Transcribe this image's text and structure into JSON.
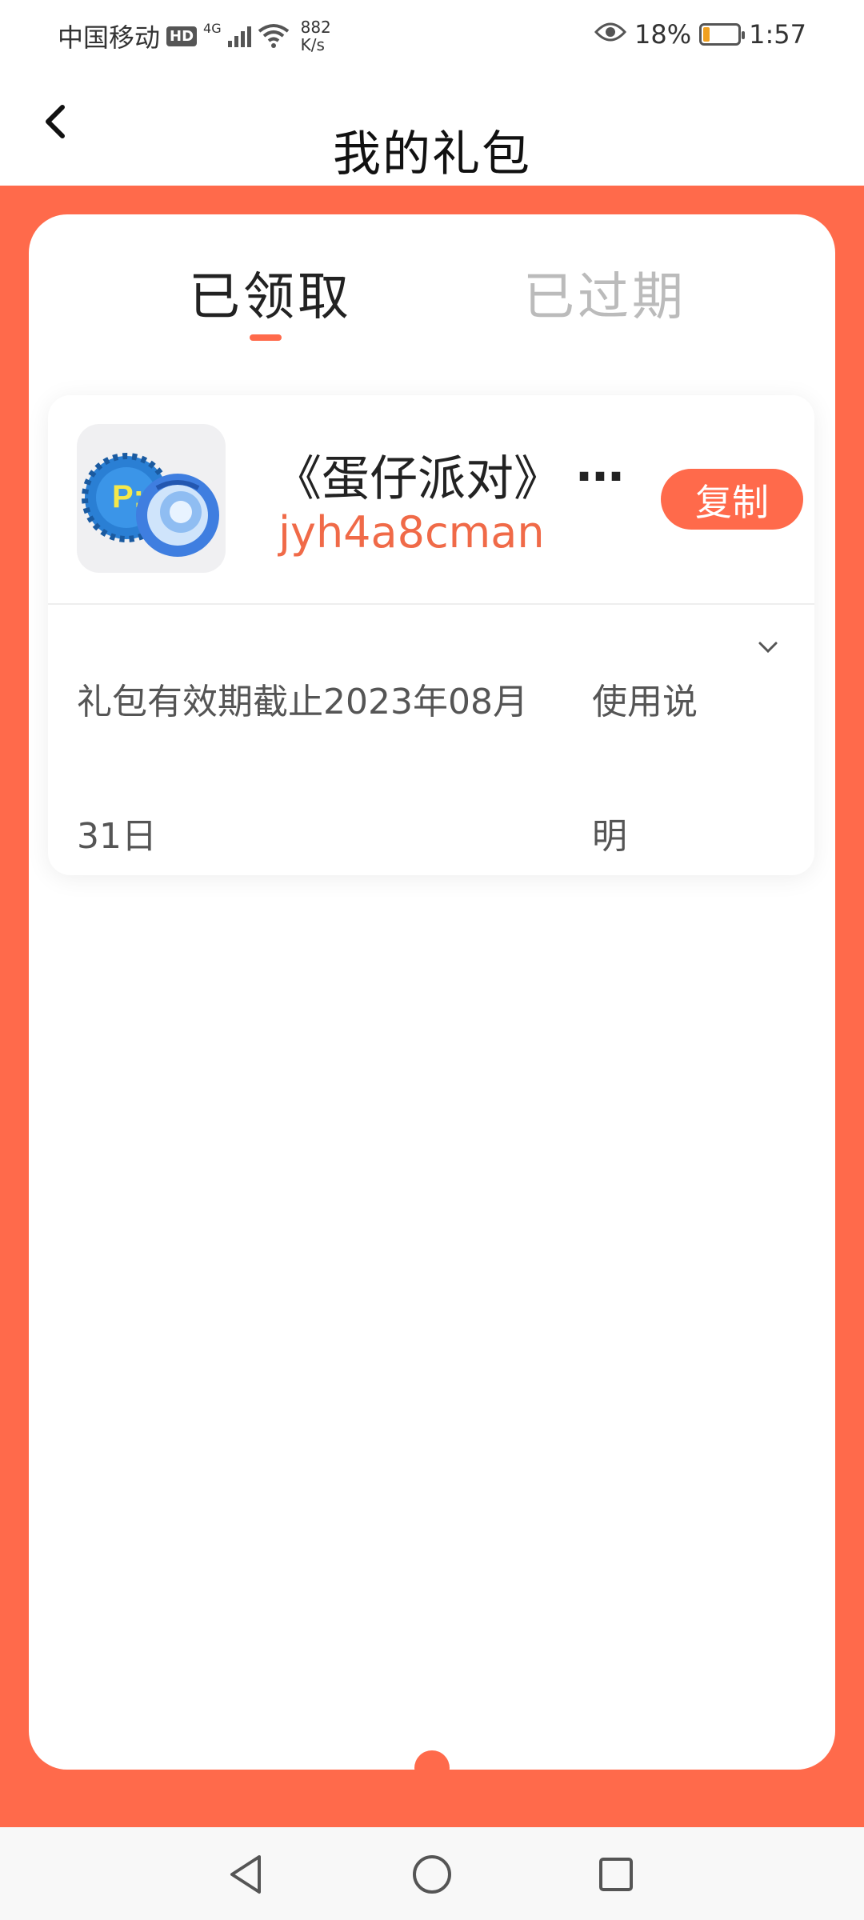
{
  "status_bar": {
    "carrier": "中国移动",
    "hd": "HD",
    "network": "4G",
    "speed_value": "882",
    "speed_unit": "K/s",
    "battery": "18%",
    "battery_level": 0.18,
    "time": "1:57"
  },
  "header": {
    "title": "我的礼包"
  },
  "tabs": [
    {
      "label": "已领取",
      "active": true
    },
    {
      "label": "已过期",
      "active": false
    }
  ],
  "gift": {
    "game_name": "《蛋仔派对》",
    "ellipsis": "…",
    "code": "jyh4a8cman",
    "copy_label": "复制",
    "expiry": "礼包有效期截止2023年08月31日",
    "usage_label": "使用说明"
  },
  "colors": {
    "accent": "#ff6a4b",
    "code_text": "#f06a48",
    "inactive_tab": "#bbbbbb"
  }
}
